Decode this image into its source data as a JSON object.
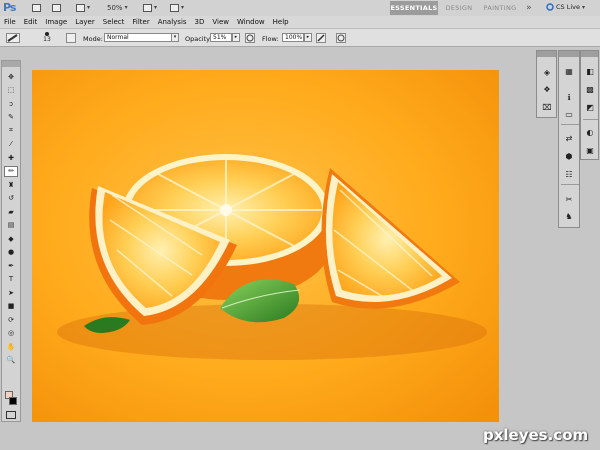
{
  "app": {
    "logo_text": "Ps"
  },
  "appbar": {
    "zoom": "50%",
    "workspaces": [
      {
        "label": "ESSENTIALS",
        "active": true
      },
      {
        "label": "DESIGN",
        "active": false
      },
      {
        "label": "PAINTING",
        "active": false
      }
    ],
    "more_glyph": "»",
    "cs_live": "CS Live"
  },
  "menu": [
    "File",
    "Edit",
    "Image",
    "Layer",
    "Select",
    "Filter",
    "Analysis",
    "3D",
    "View",
    "Window",
    "Help"
  ],
  "options": {
    "brush_size": "13",
    "mode_label": "Mode:",
    "mode_value": "Normal",
    "opacity_label": "Opacity:",
    "opacity_value": "51%",
    "flow_label": "Flow:",
    "flow_value": "100%"
  },
  "tools": [
    {
      "name": "move-tool",
      "glyph": "✥"
    },
    {
      "name": "marquee-tool",
      "glyph": "⬚"
    },
    {
      "name": "lasso-tool",
      "glyph": "ↄ"
    },
    {
      "name": "quick-select-tool",
      "glyph": "✎"
    },
    {
      "name": "crop-tool",
      "glyph": "⌗"
    },
    {
      "name": "eyedropper-tool",
      "glyph": "⁄"
    },
    {
      "name": "healing-brush-tool",
      "glyph": "✚"
    },
    {
      "name": "brush-tool",
      "glyph": "✏",
      "selected": true
    },
    {
      "name": "clone-stamp-tool",
      "glyph": "♜"
    },
    {
      "name": "history-brush-tool",
      "glyph": "↺"
    },
    {
      "name": "eraser-tool",
      "glyph": "▰"
    },
    {
      "name": "gradient-tool",
      "glyph": "▤"
    },
    {
      "name": "blur-tool",
      "glyph": "◆"
    },
    {
      "name": "dodge-tool",
      "glyph": "●"
    },
    {
      "name": "pen-tool",
      "glyph": "✒"
    },
    {
      "name": "type-tool",
      "glyph": "T"
    },
    {
      "name": "path-select-tool",
      "glyph": "➤"
    },
    {
      "name": "shape-tool",
      "glyph": "■"
    },
    {
      "name": "3d-rotate-tool",
      "glyph": "⟳"
    },
    {
      "name": "3d-orbit-tool",
      "glyph": "◎"
    },
    {
      "name": "hand-tool",
      "glyph": "✋"
    },
    {
      "name": "zoom-tool",
      "glyph": "🔍"
    }
  ],
  "panels_left": [
    "layers-panel-icon",
    "channels-panel-icon",
    "paths-panel-icon"
  ],
  "panels_right": [
    "histogram-panel-icon",
    "info-panel-icon",
    "navigator-panel-icon",
    "adjustments-panel-icon",
    "masks-panel-icon",
    "styles-panel-icon",
    "color-panel-icon",
    "swatches-panel-icon",
    "tool-presets-panel-icon",
    "brushes-panel-icon",
    "clone-source-panel-icon"
  ],
  "watermark": "pxleyes.com",
  "colors": {
    "foreground": "#f3d2bf",
    "background": "#000000",
    "canvas_bg": "#ffa20e"
  }
}
